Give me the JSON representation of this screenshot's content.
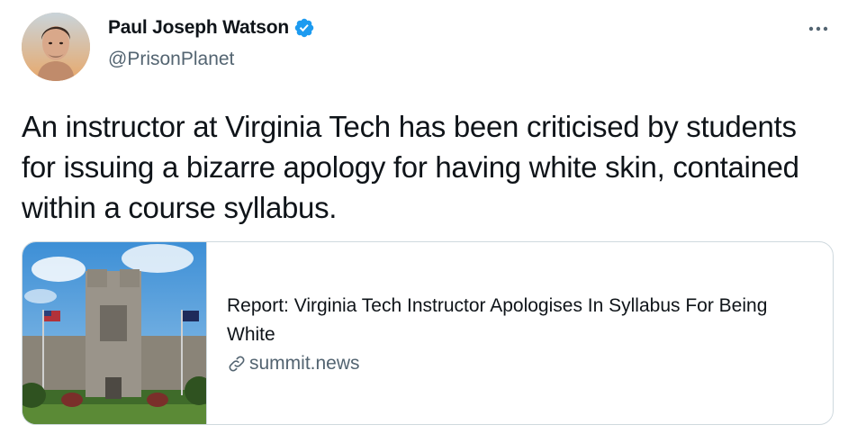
{
  "author": {
    "display_name": "Paul Joseph Watson",
    "handle": "@PrisonPlanet",
    "verified": true,
    "avatar_icon": "profile-photo"
  },
  "tweet": {
    "text": "An instructor at Virginia Tech has been criticised by students for issuing a bizarre apology for having white skin, contained within a course syllabus."
  },
  "link_card": {
    "title": "Report: Virginia Tech Instructor Apologises In Syllabus For Being White",
    "domain": "summit.news",
    "thumbnail_icon": "building-photo"
  },
  "colors": {
    "verified": "#1d9bf0",
    "muted_text": "#536471",
    "border": "#cfd9de",
    "text": "#0f1419"
  }
}
